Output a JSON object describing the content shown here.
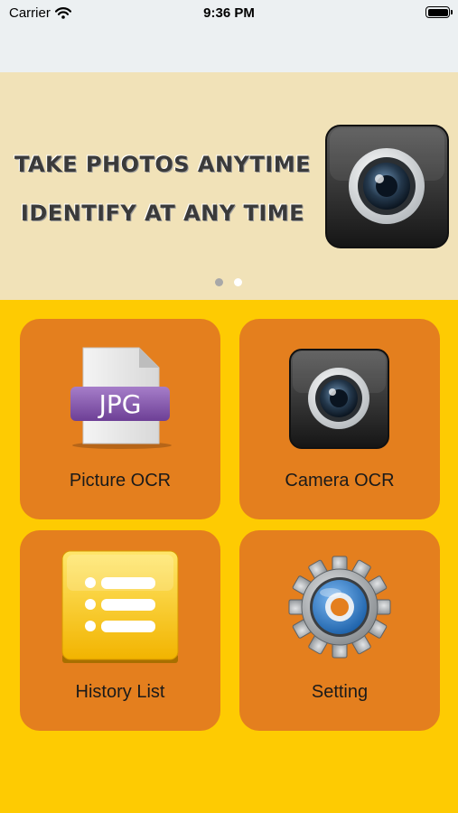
{
  "status_bar": {
    "carrier": "Carrier",
    "time": "9:36 PM"
  },
  "banner": {
    "line1": "Take photos anytime",
    "line2": "Identify at any time",
    "page_count": 2,
    "active_page": 2
  },
  "tiles": [
    {
      "label": "Picture OCR",
      "icon": "jpg-file-icon"
    },
    {
      "label": "Camera OCR",
      "icon": "camera-icon"
    },
    {
      "label": "History List",
      "icon": "list-icon"
    },
    {
      "label": "Setting",
      "icon": "gear-icon"
    }
  ],
  "file_badge": "JPG",
  "colors": {
    "background": "#fecb02",
    "tile": "#e47f1e",
    "banner": "#f1e2b8",
    "status_bar": "#ecf0f2"
  }
}
